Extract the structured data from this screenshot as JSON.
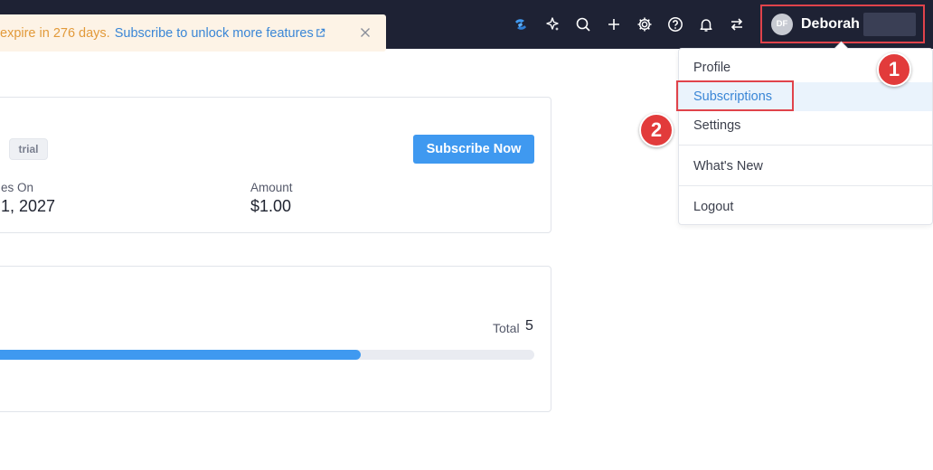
{
  "banner": {
    "expire_text": "expire in 276 days.",
    "link_text": "Subscribe to unlock more features",
    "link_icon": "external-link-icon",
    "close_icon": "close-icon"
  },
  "toolbar": {
    "icons": [
      "zia-logo-icon",
      "ai-sparkle-icon",
      "search-icon",
      "plus-icon",
      "gear-icon",
      "help-icon",
      "bell-icon",
      "switch-arrows-icon"
    ]
  },
  "user": {
    "initials": "DF",
    "name": "Deborah"
  },
  "dropdown": {
    "items": [
      "Profile",
      "Subscriptions",
      "Settings",
      "What's New",
      "Logout"
    ],
    "active": "Subscriptions"
  },
  "annotations": {
    "marker1": "1",
    "marker2": "2"
  },
  "plan_card": {
    "badge": "trial",
    "subscribe_button": "Subscribe Now",
    "expires_label": "es On",
    "expires_value": "1, 2027",
    "amount_label": "Amount",
    "amount_value": "$1.00"
  },
  "usage_card": {
    "total_label": "Total",
    "total_value": "5",
    "progress": 0.68
  },
  "colors": {
    "topbar": "#1e2234",
    "accent": "#3f99f0",
    "annotation_red": "#e23b3b",
    "banner_bg": "#fdf3e6",
    "banner_text": "#e29a3a"
  }
}
